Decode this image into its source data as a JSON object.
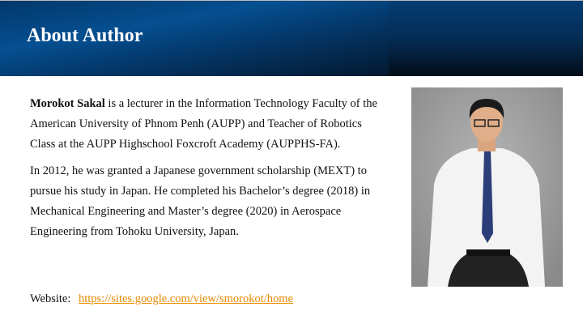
{
  "header": {
    "title": "About Author"
  },
  "bio": {
    "name": "Morokot Sakal",
    "paragraph1_rest": " is a lecturer in the Information Technology Faculty of the American University of Phnom Penh (AUPP) and Teacher of Robotics Class at the AUPP Highschool Foxcroft Academy (AUPPHS-FA).",
    "paragraph2": "In 2012, he was granted a Japanese government scholarship (MEXT) to pursue his study in Japan. He completed his Bachelor’s degree (2018) in Mechanical Engineering and Master’s degree (2020) in Aerospace Engineering from Tohoku University, Japan."
  },
  "website": {
    "label": "Website:",
    "url": "https://sites.google.com/view/smorokot/home"
  },
  "colors": {
    "header": "#054f91",
    "link": "#e88a00"
  }
}
